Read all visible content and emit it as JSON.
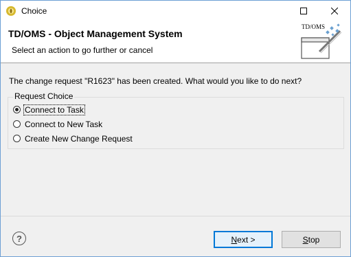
{
  "window": {
    "title": "Choice",
    "icon": "eclipse-app-icon"
  },
  "banner": {
    "title": "TD/OMS - Object Management System",
    "subtitle": "Select an action to go further or cancel",
    "art_label": "TD/OMS"
  },
  "message": "The change request \"R1623\" has been created. What would you like to do next?",
  "request_choice": {
    "label": "Request Choice",
    "options": [
      {
        "label": "Connect to Task",
        "checked": true
      },
      {
        "label": "Connect to New Task",
        "checked": false
      },
      {
        "label": "Create New Change Request",
        "checked": false
      }
    ]
  },
  "buttons": {
    "next_mnemonic": "N",
    "next_rest": "ext >",
    "stop_mnemonic": "S",
    "stop_rest": "top"
  },
  "help": {
    "glyph": "?"
  },
  "colors": {
    "focus_border": "#0078d7",
    "window_border": "#6c9fd4"
  }
}
